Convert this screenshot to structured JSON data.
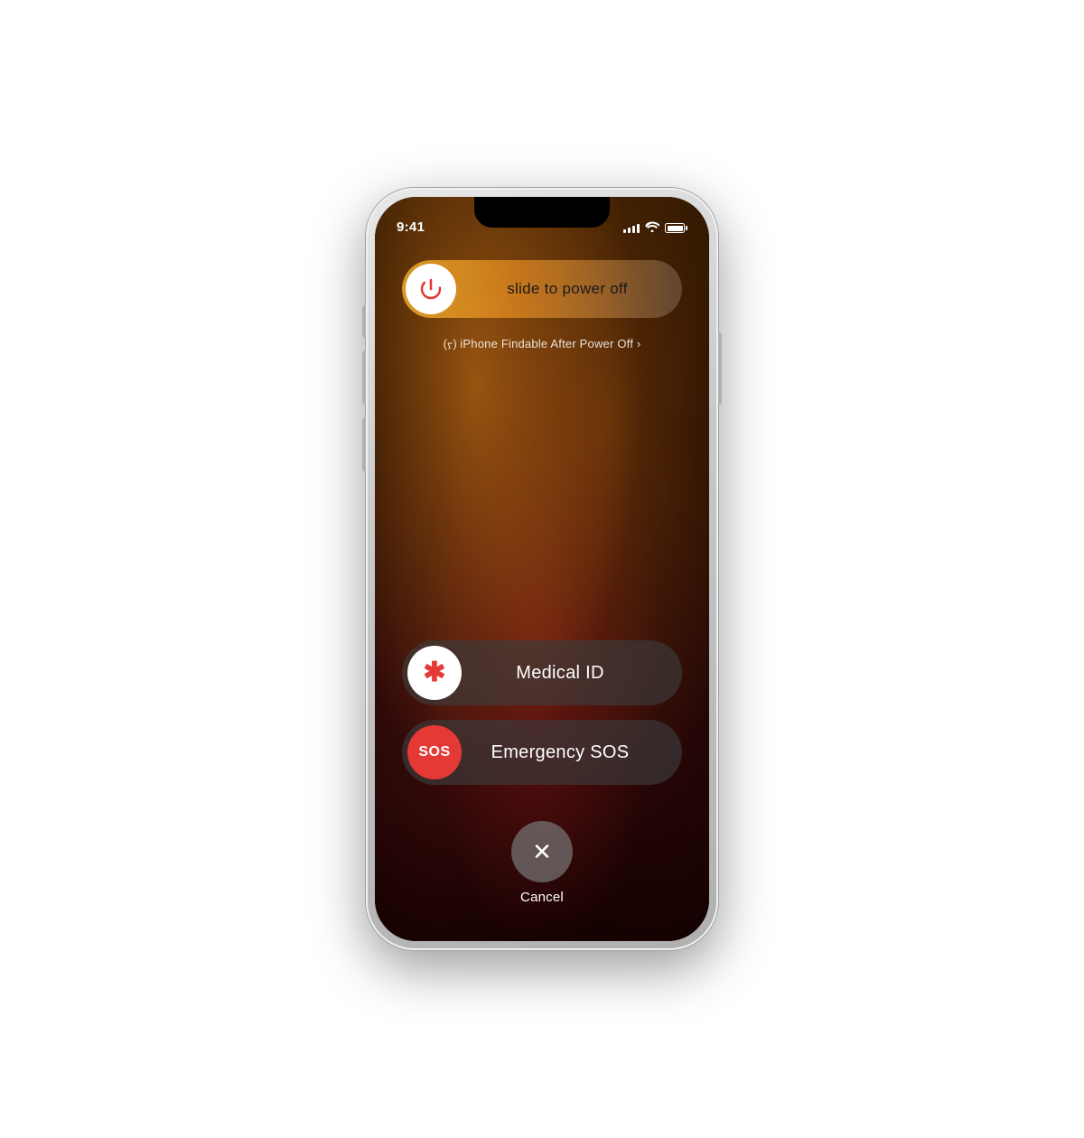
{
  "phone": {
    "status_bar": {
      "time": "9:41",
      "signal_bars": [
        4,
        6,
        8,
        10,
        12
      ],
      "battery_level": "full"
    },
    "power_slider": {
      "label": "slide to power off",
      "findable_text": "(ᠶ) iPhone Findable After Power Off ›"
    },
    "actions": [
      {
        "id": "medical-id",
        "icon_type": "star",
        "icon_label": "Medical ID",
        "label": "Medical ID"
      },
      {
        "id": "emergency-sos",
        "icon_type": "sos",
        "icon_label": "SOS",
        "label": "Emergency SOS"
      }
    ],
    "cancel": {
      "label": "Cancel"
    }
  }
}
